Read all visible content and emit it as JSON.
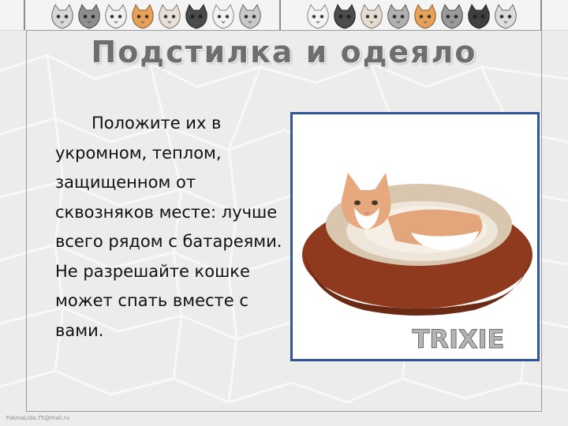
{
  "slide": {
    "title": "Подстилка и одеяло",
    "body": "Положите их в укромном, теплом, защищенном от сквозняков месте: лучше всего рядом с батареями. Не разрешайте кошке может спать вместе с вами.",
    "image_brand": "TRIXIE",
    "footer": "FokinaLida.75@mail.ru"
  },
  "icons": {
    "header_decor": "kitten-faces-icon",
    "photo": "cat-in-bed-photo"
  },
  "colors": {
    "title": "#6e6e6e",
    "photo_border": "#2f5597",
    "bed": "#9b3b1f",
    "bed_inner": "#d9c8b0"
  }
}
